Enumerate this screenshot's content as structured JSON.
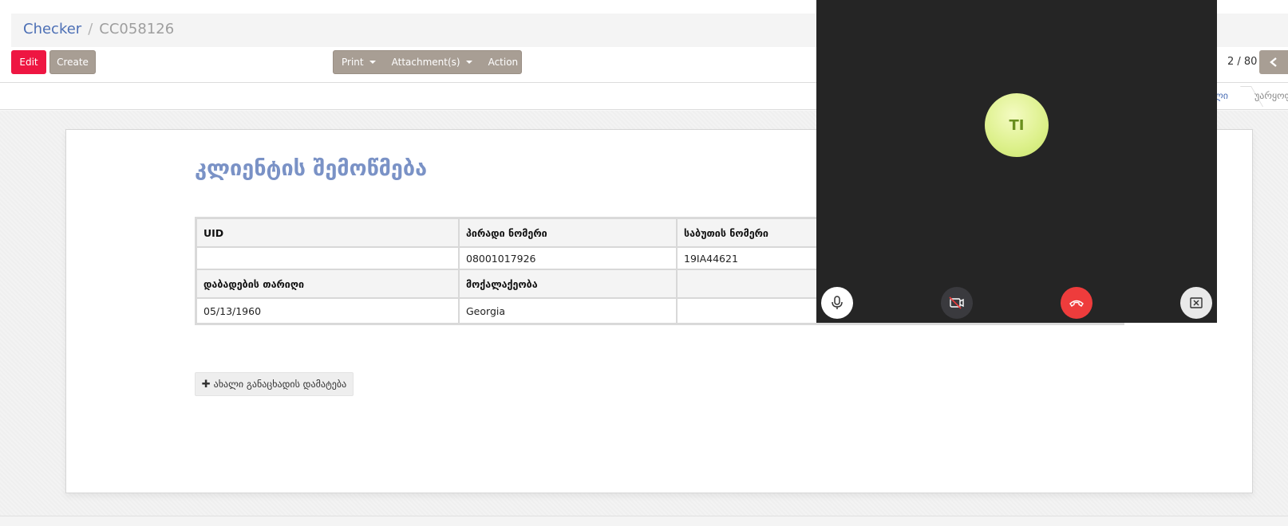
{
  "breadcrumb": {
    "parent": "Checker",
    "separator": "/",
    "current": "CC058126"
  },
  "toolbar": {
    "edit_label": "Edit",
    "create_label": "Create",
    "print_label": "Print",
    "attachments_label": "Attachment(s)",
    "action_label": "Action"
  },
  "pager": {
    "value": "2 / 80",
    "prev_icon": "chevron-left-icon"
  },
  "statusbar": {
    "stage_active": "ლი",
    "stage_next": "უარყოფ"
  },
  "form": {
    "title": "კლიენტის შემოწმება",
    "table": {
      "row1_headers": [
        "UID",
        "პირადი ნომერი",
        "საბუთის ნომერი"
      ],
      "row1_values": [
        "",
        "08001017926",
        "19IA44621"
      ],
      "row2_headers": [
        "დაბადების თარიღი",
        "მოქალაქეობა",
        ""
      ],
      "row2_values": [
        "05/13/1960",
        "Georgia",
        ""
      ]
    },
    "add_button_label": "ახალი განაცხადის დამატება"
  },
  "video_call": {
    "avatar_initials": "TI",
    "buttons": [
      "microphone-icon",
      "camera-off-icon",
      "hangup-icon",
      "close-window-icon"
    ],
    "colors": {
      "panel_bg": "#252525",
      "hangup": "#ee3c3c",
      "avatar": "#dcf08a"
    }
  },
  "colors": {
    "edit_button": "#ee1642",
    "secondary_button": "#a89e94",
    "link": "#4c6fb5",
    "title": "#7a92c6"
  }
}
